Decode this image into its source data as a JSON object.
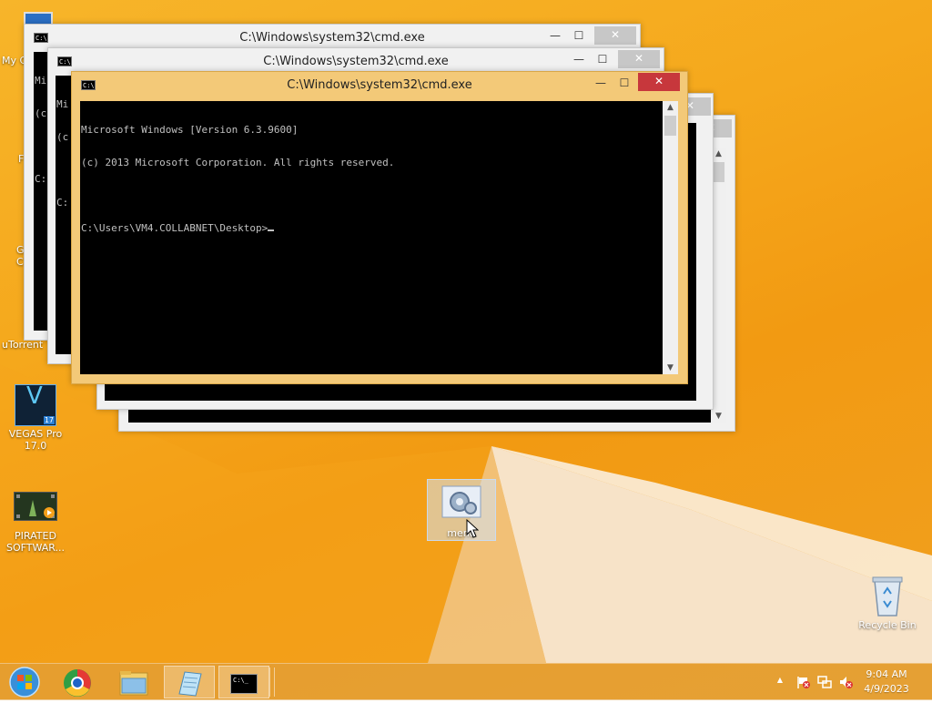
{
  "desktop": {
    "icons": [
      {
        "id": "my-computer",
        "label": "My C"
      },
      {
        "id": "icon-f",
        "label": "F"
      },
      {
        "id": "google-chrome",
        "label": "G\nC"
      },
      {
        "id": "utorrent",
        "label": "uTorrent"
      },
      {
        "id": "vegas-pro",
        "label": "VEGAS Pro\n17.0"
      },
      {
        "id": "pirated-software",
        "label": "PIRATED\nSOFTWAR..."
      },
      {
        "id": "menu",
        "label": "menu"
      },
      {
        "id": "recycle-bin",
        "label": "Recycle Bin"
      }
    ],
    "vegas_badge": "17",
    "vegas_letter": "V"
  },
  "windows": [
    {
      "title": "C:\\Windows\\system32\\cmd.exe",
      "lines": [
        "Mi",
        "(c",
        "",
        "C:"
      ]
    },
    {
      "title": "C:\\Windows\\system32\\cmd.exe",
      "lines": [
        "Mi",
        "(c",
        "",
        "C:"
      ]
    },
    {
      "title": "C:\\Windows\\system32\\cmd.exe",
      "lines": [
        ""
      ]
    },
    {
      "title": "C:\\Windows\\system32\\cmd.exe",
      "lines": [
        "Microsoft Windows [Version 6.3.9600]",
        "(c) 2013 Microsoft Corporation. All rights reserved.",
        "",
        "C:\\Users\\VM4.COLLABNET\\Desktop>"
      ]
    }
  ],
  "window_buttons": {
    "minimize": "—",
    "maximize": "☐",
    "close": "✕"
  },
  "taskbar": {
    "pinned": [
      "start-button",
      "chrome",
      "file-explorer",
      "notepad",
      "cmd"
    ],
    "cmd_icon_text": "C:\\_",
    "clock": {
      "time": "9:04 AM",
      "date": "4/9/2023"
    },
    "tray": {
      "overflow": "▲"
    }
  },
  "colors": {
    "active_title": "#f3c978",
    "close_button": "#c7373c",
    "console_bg": "#000000",
    "console_fg": "#c0c0c0"
  }
}
